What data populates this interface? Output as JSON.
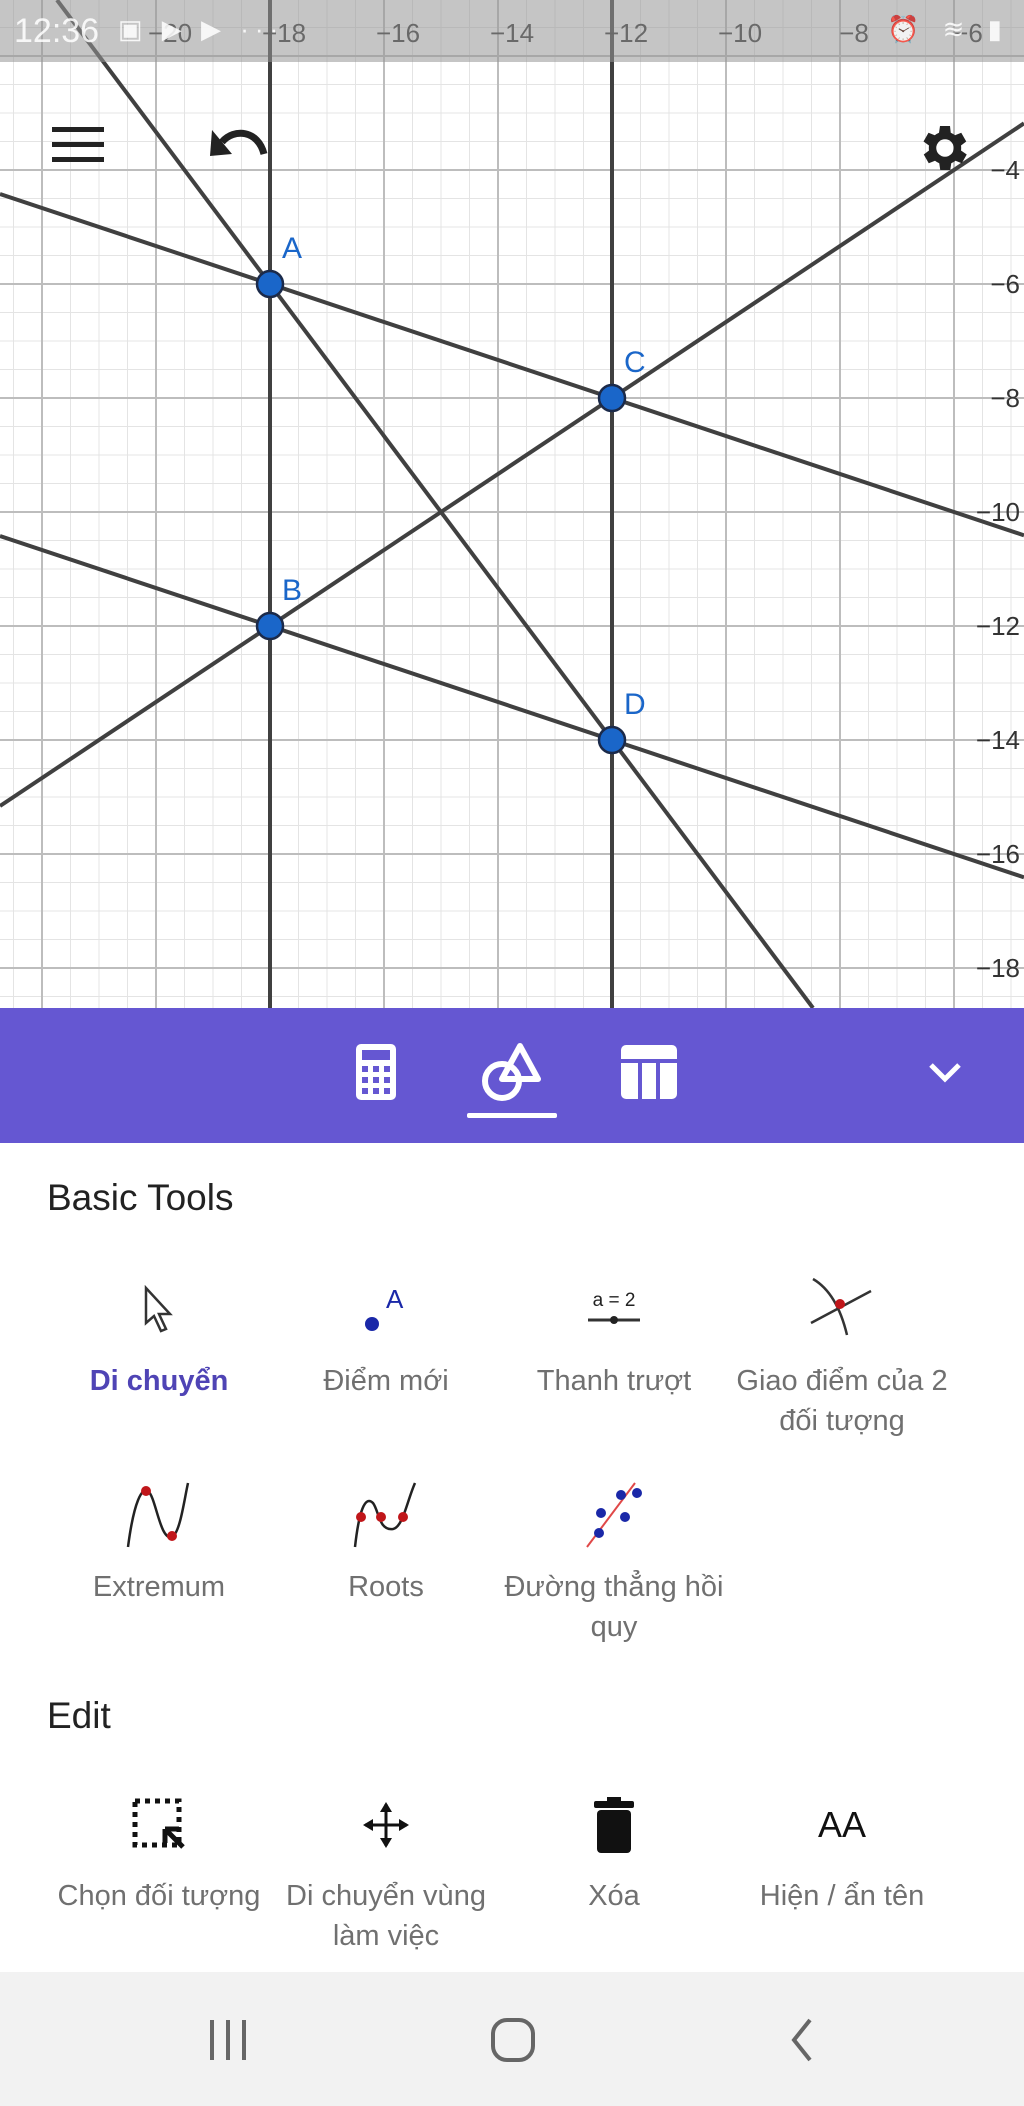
{
  "status_bar": {
    "time": "12:36",
    "left_icons": "▣ ▶ ▶ ···",
    "right_icons": "⏰ ≋ ▮"
  },
  "graph": {
    "x_ticks": [
      -20,
      -18,
      -16,
      -14,
      -12,
      -10,
      -8,
      -6
    ],
    "y_ticks": [
      -4,
      -6,
      -8,
      -10,
      -12,
      -14,
      -16,
      -18
    ],
    "points": [
      {
        "name": "A",
        "x": -18,
        "y": -6
      },
      {
        "name": "B",
        "x": -18,
        "y": -12
      },
      {
        "name": "C",
        "x": -12,
        "y": -8
      },
      {
        "name": "D",
        "x": -12,
        "y": -14
      }
    ],
    "lines": [
      [
        "A",
        "B"
      ],
      [
        "C",
        "D"
      ],
      [
        "A",
        "C"
      ],
      [
        "B",
        "D"
      ],
      [
        "B",
        "C"
      ],
      [
        "A",
        "D"
      ]
    ],
    "point_color": "#1a66c9",
    "line_color": "#404040"
  },
  "graph_buttons": {
    "menu": "menu-icon",
    "undo": "undo-icon",
    "settings": "gear-icon"
  },
  "toolbar": {
    "accent": "#6557d2",
    "tabs": [
      {
        "name": "algebra",
        "icon": "calculator-icon"
      },
      {
        "name": "tools",
        "icon": "geometry-tools-icon",
        "active": true
      },
      {
        "name": "table",
        "icon": "table-icon"
      }
    ],
    "collapse_icon": "chevron-down-icon"
  },
  "sections": [
    {
      "title": "Basic Tools",
      "tools": [
        {
          "label": "Di chuyển",
          "icon": "pointer-arrow-icon",
          "selected": true
        },
        {
          "label": "Điểm mới",
          "icon": "new-point-icon"
        },
        {
          "label": "Thanh trượt",
          "icon": "slider-icon",
          "icon_text": "a = 2"
        },
        {
          "label": "Giao điểm của 2 đối tượng",
          "icon": "intersect-icon"
        },
        {
          "label": "Extremum",
          "icon": "extremum-icon"
        },
        {
          "label": "Roots",
          "icon": "roots-icon"
        },
        {
          "label": "Đường thẳng hồi quy",
          "icon": "fit-line-icon"
        }
      ]
    },
    {
      "title": "Edit",
      "tools": [
        {
          "label": "Chọn đối tượng",
          "icon": "select-objects-icon"
        },
        {
          "label": "Di chuyển vùng làm việc",
          "icon": "move-graphics-icon"
        },
        {
          "label": "Xóa",
          "icon": "delete-icon"
        },
        {
          "label": "Hiện / ẩn tên",
          "icon": "show-hide-label-icon",
          "icon_text": "AA"
        }
      ]
    }
  ],
  "nav_bar": {
    "recent": "recent-apps-icon",
    "home": "home-icon",
    "back": "back-icon"
  }
}
